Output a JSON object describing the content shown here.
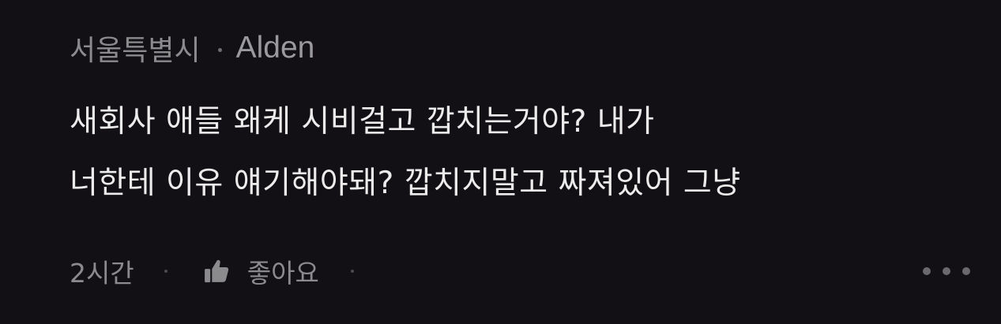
{
  "comment": {
    "location": "서울특별시",
    "author": "Alden",
    "lines": [
      "새회사 애들 왜케 시비걸고 깝치는거야? 내가",
      "너한테 이유 얘기해야돼? 깝치지말고 짜져있어 그냥"
    ],
    "time": "2시간",
    "like_label": "좋아요"
  },
  "icons": {
    "like": "thumbs-up-icon",
    "more": "more-horizontal-icon"
  },
  "colors": {
    "background": "#121014",
    "text": "#ececec",
    "muted": "#8b8b8e"
  }
}
